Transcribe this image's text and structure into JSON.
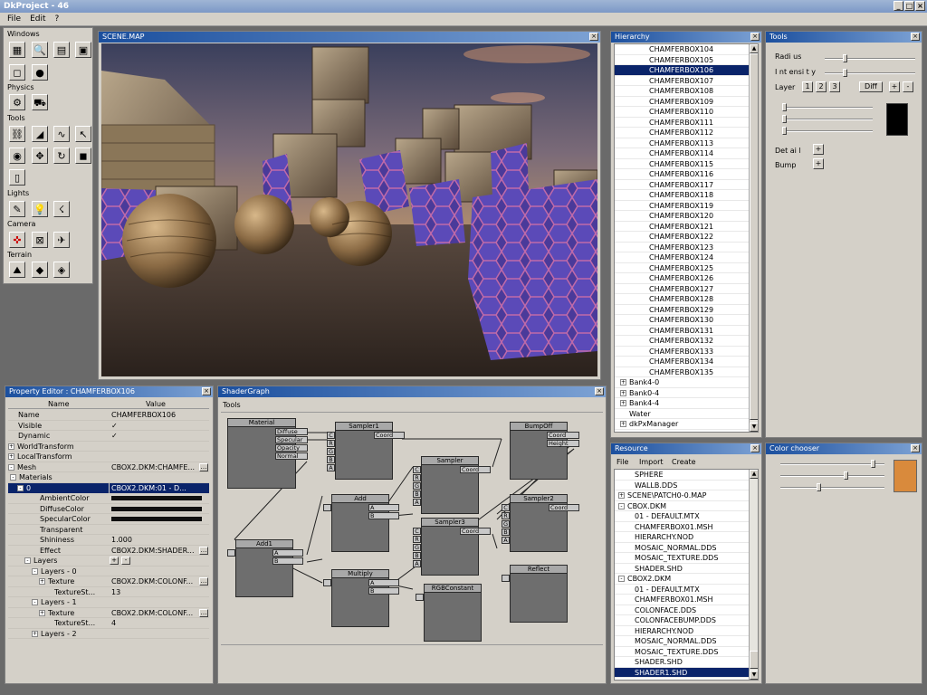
{
  "app": {
    "title": "DkProject - 46"
  },
  "menu": [
    "File",
    "Edit",
    "?"
  ],
  "toolbox": {
    "sections": [
      "Windows",
      "Physics",
      "Tools",
      "Lights",
      "Camera",
      "Terrain"
    ]
  },
  "scene": {
    "title": "SCENE.MAP"
  },
  "hierarchy": {
    "title": "Hierarchy",
    "items": [
      {
        "label": "CHAMFERBOX104",
        "expander": false
      },
      {
        "label": "CHAMFERBOX105",
        "expander": false
      },
      {
        "label": "CHAMFERBOX106",
        "expander": false,
        "selected": true
      },
      {
        "label": "CHAMFERBOX107",
        "expander": false
      },
      {
        "label": "CHAMFERBOX108",
        "expander": false
      },
      {
        "label": "CHAMFERBOX109",
        "expander": false
      },
      {
        "label": "CHAMFERBOX110",
        "expander": false
      },
      {
        "label": "CHAMFERBOX111",
        "expander": false
      },
      {
        "label": "CHAMFERBOX112",
        "expander": false
      },
      {
        "label": "CHAMFERBOX113",
        "expander": false
      },
      {
        "label": "CHAMFERBOX114",
        "expander": false
      },
      {
        "label": "CHAMFERBOX115",
        "expander": false
      },
      {
        "label": "CHAMFERBOX116",
        "expander": false
      },
      {
        "label": "CHAMFERBOX117",
        "expander": false
      },
      {
        "label": "CHAMFERBOX118",
        "expander": false
      },
      {
        "label": "CHAMFERBOX119",
        "expander": false
      },
      {
        "label": "CHAMFERBOX120",
        "expander": false
      },
      {
        "label": "CHAMFERBOX121",
        "expander": false
      },
      {
        "label": "CHAMFERBOX122",
        "expander": false
      },
      {
        "label": "CHAMFERBOX123",
        "expander": false
      },
      {
        "label": "CHAMFERBOX124",
        "expander": false
      },
      {
        "label": "CHAMFERBOX125",
        "expander": false
      },
      {
        "label": "CHAMFERBOX126",
        "expander": false
      },
      {
        "label": "CHAMFERBOX127",
        "expander": false
      },
      {
        "label": "CHAMFERBOX128",
        "expander": false
      },
      {
        "label": "CHAMFERBOX129",
        "expander": false
      },
      {
        "label": "CHAMFERBOX130",
        "expander": false
      },
      {
        "label": "CHAMFERBOX131",
        "expander": false
      },
      {
        "label": "CHAMFERBOX132",
        "expander": false
      },
      {
        "label": "CHAMFERBOX133",
        "expander": false
      },
      {
        "label": "CHAMFERBOX134",
        "expander": false
      },
      {
        "label": "CHAMFERBOX135",
        "expander": false
      },
      {
        "label": "Bank4-0",
        "expander": true,
        "top": true
      },
      {
        "label": "Bank0-4",
        "expander": true,
        "top": true
      },
      {
        "label": "Bank4-4",
        "expander": true,
        "top": true
      },
      {
        "label": "Water",
        "expander": false,
        "top": true
      },
      {
        "label": "dkPxManager",
        "expander": true,
        "top": true
      }
    ]
  },
  "tools": {
    "title": "Tools",
    "radius_label": "Radi us",
    "intensity_label": "I nt ensi t y",
    "layer_label": "Layer",
    "layer_buttons": [
      "1",
      "2",
      "3"
    ],
    "diff_label": "Diff",
    "plus": "+",
    "minus": "-",
    "detail_label": "Det ai l",
    "bump_label": "Bump",
    "preview_color": "#000000"
  },
  "property_editor": {
    "title": "Property Editor : CHAMFERBOX106",
    "col_name": "Name",
    "col_value": "Value",
    "rows": [
      {
        "name": "Name",
        "value": "CHAMFERBOX106",
        "indent": 1,
        "exp": ""
      },
      {
        "name": "Visible",
        "value": "✓",
        "indent": 1,
        "exp": ""
      },
      {
        "name": "Dynamic",
        "value": "✓",
        "indent": 1,
        "exp": ""
      },
      {
        "name": "WorldTransform",
        "value": "",
        "indent": 0,
        "exp": "+"
      },
      {
        "name": "LocalTransform",
        "value": "",
        "indent": 0,
        "exp": "+"
      },
      {
        "name": "Mesh",
        "value": "CBOX2.DKM:CHAMFE...",
        "indent": 0,
        "exp": "-",
        "btn": true
      },
      {
        "name": "Materials",
        "value": "",
        "indent": 1,
        "exp": "-"
      },
      {
        "name": "0",
        "value": "CBOX2.DKM:01 - D...",
        "indent": 2,
        "exp": "-",
        "selected": true
      },
      {
        "name": "AmbientColor",
        "value": "",
        "indent": 4,
        "exp": "",
        "color": true
      },
      {
        "name": "DiffuseColor",
        "value": "",
        "indent": 4,
        "exp": "",
        "color": true
      },
      {
        "name": "SpecularColor",
        "value": "",
        "indent": 4,
        "exp": "",
        "color": true
      },
      {
        "name": "Transparent",
        "value": "",
        "indent": 4,
        "exp": ""
      },
      {
        "name": "Shininess",
        "value": "1.000",
        "indent": 4,
        "exp": ""
      },
      {
        "name": "Effect",
        "value": "CBOX2.DKM:SHADER...",
        "indent": 4,
        "exp": "",
        "btn": true
      },
      {
        "name": "Layers",
        "value": "",
        "indent": 3,
        "exp": "-",
        "pm": true
      },
      {
        "name": "Layers - 0",
        "value": "",
        "indent": 4,
        "exp": "-"
      },
      {
        "name": "Texture",
        "value": "CBOX2.DKM:COLONF...",
        "indent": 5,
        "exp": "+",
        "btn": true
      },
      {
        "name": "TextureSt...",
        "value": "13",
        "indent": 6,
        "exp": ""
      },
      {
        "name": "Layers - 1",
        "value": "",
        "indent": 4,
        "exp": "-"
      },
      {
        "name": "Texture",
        "value": "CBOX2.DKM:COLONF...",
        "indent": 5,
        "exp": "+",
        "btn": true
      },
      {
        "name": "TextureSt...",
        "value": "4",
        "indent": 6,
        "exp": ""
      },
      {
        "name": "Layers - 2",
        "value": "",
        "indent": 4,
        "exp": "+"
      }
    ]
  },
  "shader_graph": {
    "title": "ShaderGraph",
    "menu": "Tools",
    "nodes": {
      "material": {
        "title": "Material",
        "outputs": [
          "Diffuse",
          "Specular",
          "Opacity",
          "Normal"
        ]
      },
      "sampler1": {
        "title": "Sampler1",
        "output": "Coord",
        "inputs": [
          "C",
          "R",
          "G",
          "B",
          "A"
        ]
      },
      "sampler": {
        "title": "Sampler",
        "output": "Coord",
        "inputs": [
          "C",
          "R",
          "G",
          "B",
          "A"
        ]
      },
      "bumpoff": {
        "title": "BumpOff",
        "outputs": [
          "Coord",
          "Height"
        ]
      },
      "add": {
        "title": "Add",
        "inputs": [
          "A",
          "B"
        ]
      },
      "sampler3": {
        "title": "Sampler3",
        "output": "Coord",
        "inputs": [
          "C",
          "R",
          "G",
          "B",
          "A"
        ]
      },
      "sampler2": {
        "title": "Sampler2",
        "output": "Coord",
        "inputs": [
          "C",
          "R",
          "G",
          "B",
          "A"
        ]
      },
      "add1": {
        "title": "Add1",
        "inputs": [
          "A",
          "B"
        ]
      },
      "multiply": {
        "title": "Multiply",
        "inputs": [
          "A",
          "B"
        ]
      },
      "rgbconstant": {
        "title": "RGBConstant"
      },
      "reflect": {
        "title": "Reflect"
      }
    }
  },
  "resource": {
    "title": "Resource",
    "menu": [
      "File",
      "Import",
      "Create"
    ],
    "items": [
      {
        "label": "SPHERE",
        "level": 1,
        "exp": ""
      },
      {
        "label": "WALLB.DDS",
        "level": 1,
        "exp": ""
      },
      {
        "label": "SCENE\\PATCH0-0.MAP",
        "level": 0,
        "exp": "+"
      },
      {
        "label": "CBOX.DKM",
        "level": 0,
        "exp": "-"
      },
      {
        "label": "01 - DEFAULT.MTX",
        "level": 1,
        "exp": ""
      },
      {
        "label": "CHAMFERBOX01.MSH",
        "level": 1,
        "exp": ""
      },
      {
        "label": "HIERARCHY.NOD",
        "level": 1,
        "exp": ""
      },
      {
        "label": "MOSAIC_NORMAL.DDS",
        "level": 1,
        "exp": ""
      },
      {
        "label": "MOSAIC_TEXTURE.DDS",
        "level": 1,
        "exp": ""
      },
      {
        "label": "SHADER.SHD",
        "level": 1,
        "exp": ""
      },
      {
        "label": "CBOX2.DKM",
        "level": 0,
        "exp": "-"
      },
      {
        "label": "01 - DEFAULT.MTX",
        "level": 1,
        "exp": ""
      },
      {
        "label": "CHAMFERBOX01.MSH",
        "level": 1,
        "exp": ""
      },
      {
        "label": "COLONFACE.DDS",
        "level": 1,
        "exp": ""
      },
      {
        "label": "COLONFACEBUMP.DDS",
        "level": 1,
        "exp": ""
      },
      {
        "label": "HIERARCHY.NOD",
        "level": 1,
        "exp": ""
      },
      {
        "label": "MOSAIC_NORMAL.DDS",
        "level": 1,
        "exp": ""
      },
      {
        "label": "MOSAIC_TEXTURE.DDS",
        "level": 1,
        "exp": ""
      },
      {
        "label": "SHADER.SHD",
        "level": 1,
        "exp": ""
      },
      {
        "label": "SHADER1.SHD",
        "level": 1,
        "exp": "",
        "selected": true
      }
    ]
  },
  "color_chooser": {
    "title": "Color chooser",
    "swatch": "#d98a3c"
  }
}
